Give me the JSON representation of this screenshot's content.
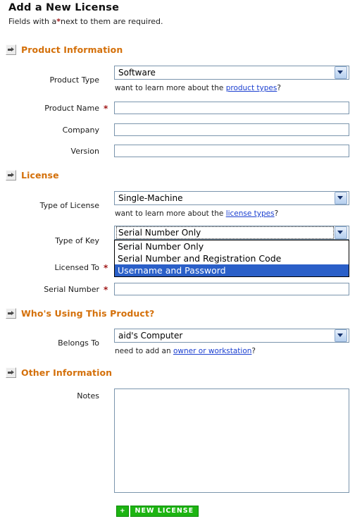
{
  "header": {
    "title": "Add a New License",
    "subtitle_before": "Fields with a",
    "subtitle_star": "*",
    "subtitle_after": "next to them are required."
  },
  "sections": {
    "product": {
      "title": "Product Information",
      "icon": "arrow-right-icon",
      "fields": {
        "product_type": {
          "label": "Product Type",
          "value": "Software",
          "hint_before": "want to learn more about the ",
          "hint_link": "product types",
          "hint_after": "?"
        },
        "product_name": {
          "label": "Product Name",
          "required": "*",
          "value": ""
        },
        "company": {
          "label": "Company",
          "value": ""
        },
        "version": {
          "label": "Version",
          "value": ""
        }
      }
    },
    "license": {
      "title": "License",
      "icon": "arrow-right-icon",
      "fields": {
        "type_of_license": {
          "label": "Type of License",
          "value": "Single-Machine",
          "hint_before": "want to learn more about the ",
          "hint_link": "license types",
          "hint_after": "?"
        },
        "type_of_key": {
          "label": "Type of Key",
          "value": "Serial Number Only",
          "expanded": true,
          "options": [
            {
              "label": "Serial Number Only",
              "selected": false
            },
            {
              "label": "Serial Number and Registration Code",
              "selected": false
            },
            {
              "label": "Username and Password",
              "selected": true
            }
          ]
        },
        "licensed_to": {
          "label": "Licensed To",
          "required": "*",
          "value": ""
        },
        "serial_number": {
          "label": "Serial Number",
          "required": "*",
          "value": ""
        }
      }
    },
    "users": {
      "title": "Who's Using This Product?",
      "icon": "arrow-right-icon",
      "fields": {
        "belongs_to": {
          "label": "Belongs To",
          "value": "aid's Computer",
          "hint_before": "need to add an ",
          "hint_link": "owner or workstation",
          "hint_after": "?"
        }
      }
    },
    "other": {
      "title": "Other Information",
      "icon": "arrow-right-icon",
      "fields": {
        "notes": {
          "label": "Notes",
          "value": ""
        }
      }
    }
  },
  "submit": {
    "plus": "+",
    "label": "NEW LICENSE"
  },
  "colors": {
    "section_title": "#d4700a",
    "required_star": "#a01818",
    "link": "#1b3fd0",
    "input_border": "#7b95ad",
    "dropdown_highlight": "#2a5fc8",
    "button_green": "#1db412"
  }
}
